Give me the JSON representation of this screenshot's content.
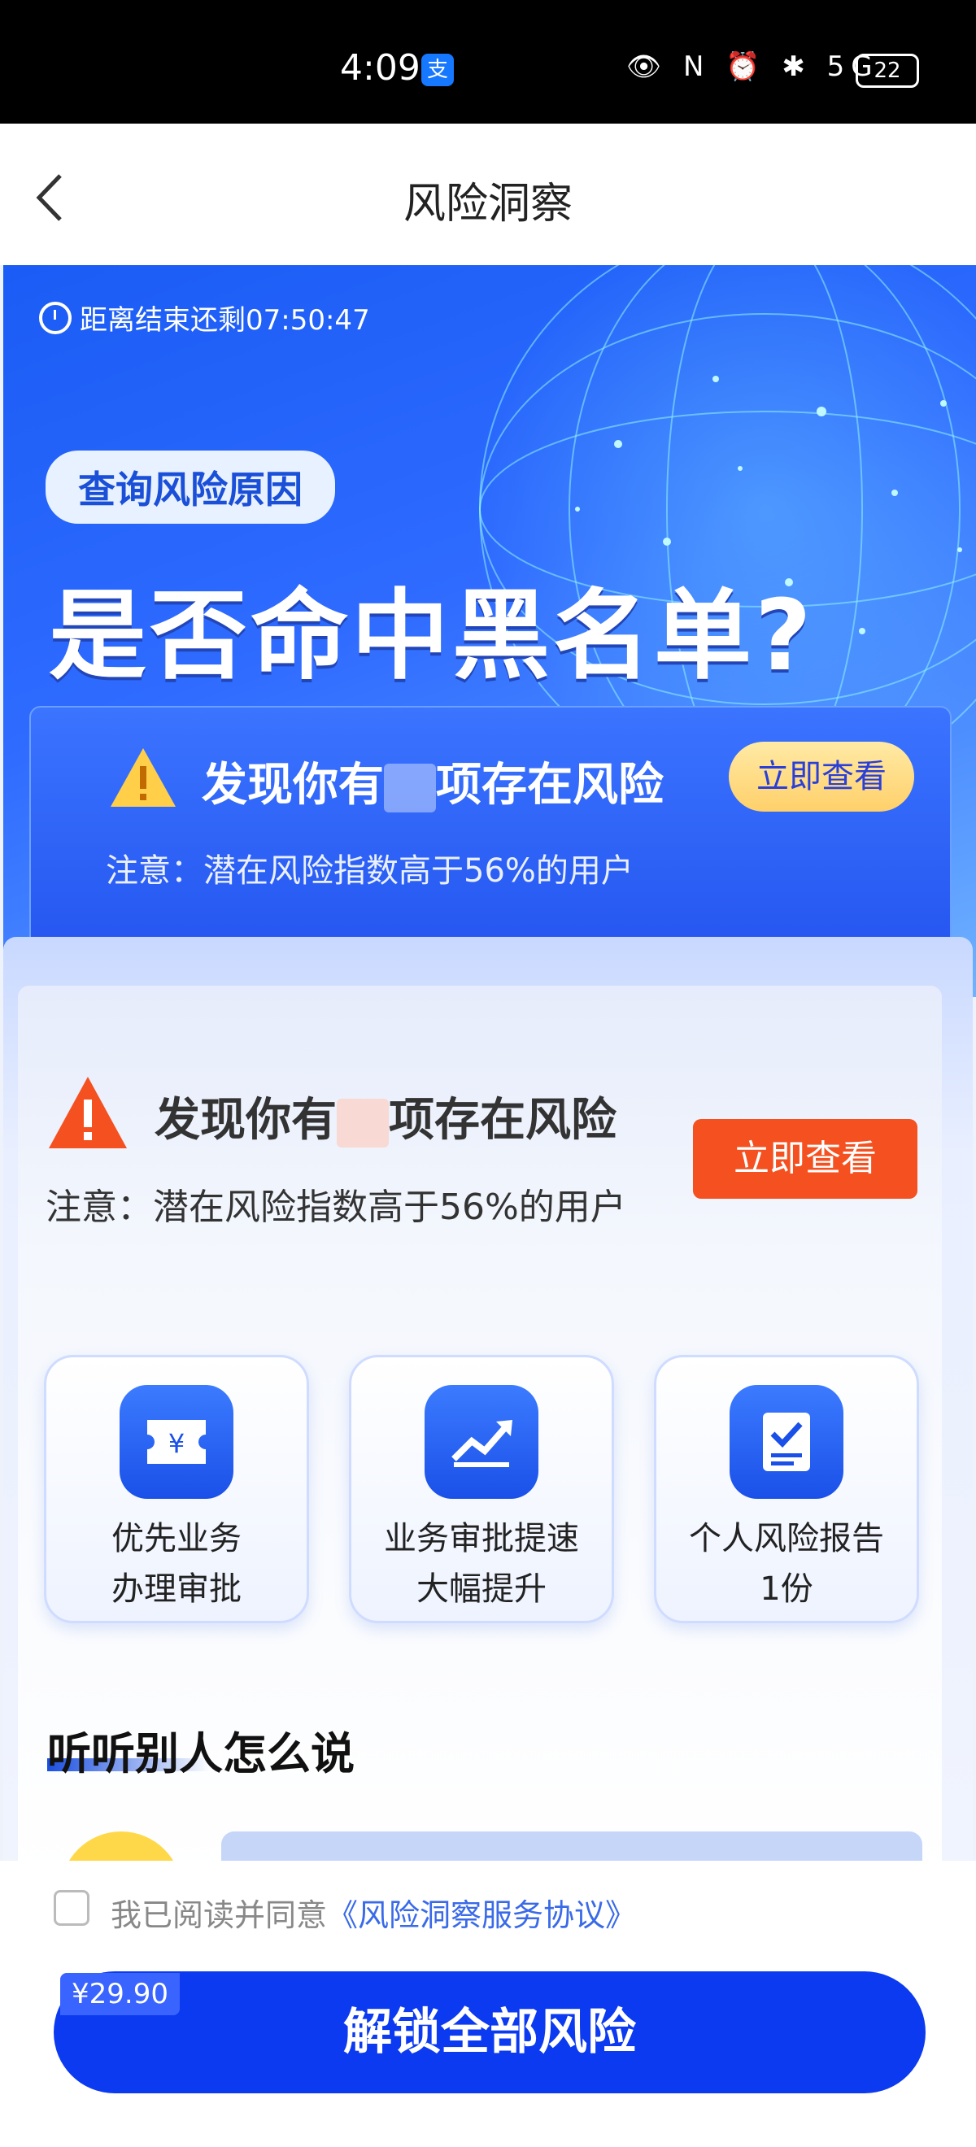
{
  "status_bar": {
    "time": "4:09",
    "app_badge": "支",
    "icons": "👁 N ⏰ ✱ 5G",
    "battery": "22"
  },
  "nav": {
    "back_icon": "chevron-left-icon",
    "title": "风险洞察"
  },
  "banner": {
    "countdown": "距离结束还剩07:50:47",
    "pill": "查询风险原因",
    "headline": "是否命中黑名单?",
    "risk_prefix": "发现你有",
    "risk_suffix": "项存在风险",
    "view_button": "立即查看",
    "note": "注意：潜在风险指数高于56%的用户"
  },
  "card": {
    "risk_prefix": "发现你有",
    "risk_suffix": "项存在风险",
    "note": "注意：潜在风险指数高于56%的用户",
    "view_button": "立即查看",
    "features": [
      {
        "icon": "ticket-yen-icon",
        "line1": "优先业务",
        "line2": "办理审批"
      },
      {
        "icon": "trend-up-icon",
        "line1": "业务审批提速",
        "line2": "大幅提升"
      },
      {
        "icon": "report-check-icon",
        "line1": "个人风险报告",
        "line2": "1份"
      }
    ],
    "reviews_title": "听听别人怎么说"
  },
  "bottom": {
    "agree_text": "我已阅读并同意",
    "agree_link": "《风险洞察服务协议》",
    "price": "¥29.90",
    "unlock_button": "解锁全部风险"
  },
  "colors": {
    "accent_blue": "#0b3af0",
    "warn_orange": "#f5501f",
    "gold": "#ffd06a"
  }
}
